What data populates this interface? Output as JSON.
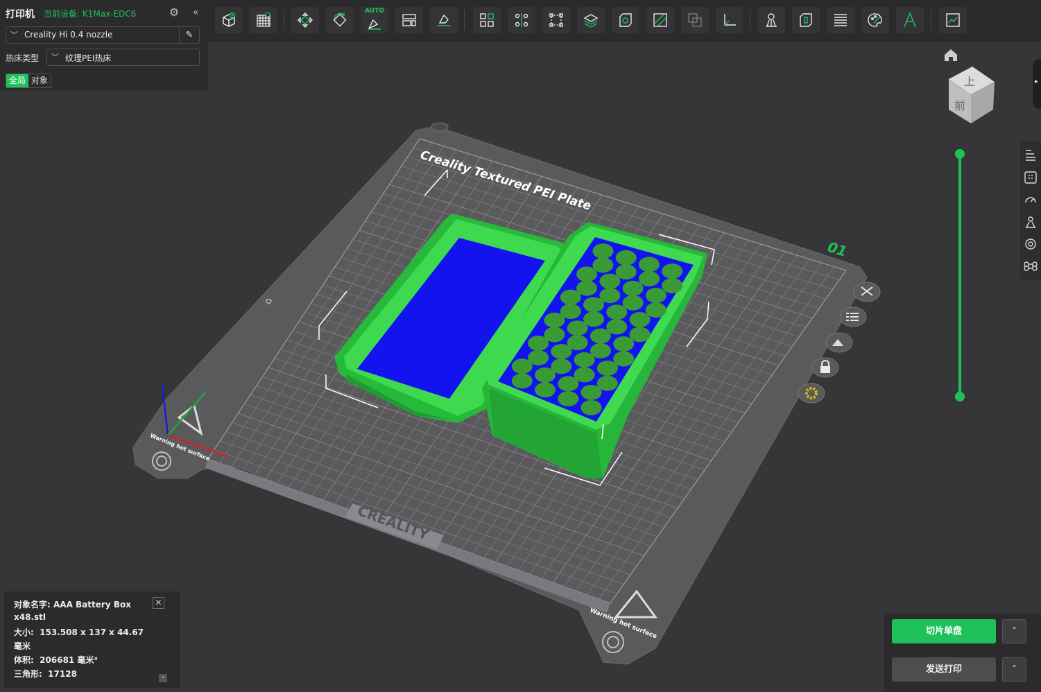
{
  "printer_panel": {
    "title": "打印机",
    "device_label": "当前设备: K1Max-EDC6",
    "nozzle": "Creality Hi 0.4 nozzle",
    "bed_type_label": "热床类型",
    "bed_type_value": "纹理PEI热床",
    "tabs": [
      {
        "label": "全局",
        "active": true
      },
      {
        "label": "对象",
        "active": false
      }
    ]
  },
  "toolbar": {
    "auto_badge": "AUTO",
    "buttons": [
      "add-object-icon",
      "plate-grid-icon",
      "arrange-icon",
      "orient-icon",
      "auto-orient-icon",
      "split-layout-icon",
      "lay-flat-icon",
      "split-parts-icon",
      "cut-icon",
      "bounding-box-icon",
      "support-paint-icon",
      "hollow-icon",
      "seam-paint-icon",
      "boolean-icon",
      "measure-icon",
      "support-icon",
      "shell-icon",
      "layer-icon",
      "color-paint-icon",
      "text-icon",
      "assembly-view-icon"
    ]
  },
  "plate": {
    "title": "Creality Textured PEI Plate",
    "plate_number": "01",
    "brand": "CREALITY",
    "warning_text": "Warning hot surface"
  },
  "view_cube": {
    "top_label": "上",
    "front_label": "前"
  },
  "object_info": {
    "name_label": "对象名字:",
    "name_value": "AAA Battery Box",
    "name_value_line2": "x48.stl",
    "size_label": "大小:",
    "size_value": "153.508 x 137 x 44.67",
    "size_unit": "毫米",
    "volume_label": "体积:",
    "volume_value": "206681 毫米³",
    "triangles_label": "三角形:",
    "triangles_value": "17128"
  },
  "actions": {
    "slice_label": "切片单盘",
    "send_label": "发送打印",
    "arrow": "˄"
  },
  "colors": {
    "accent": "#1fc25a",
    "object_green": "#2fcf45",
    "object_blue": "#1414f0",
    "plate": "#5d5d60"
  }
}
